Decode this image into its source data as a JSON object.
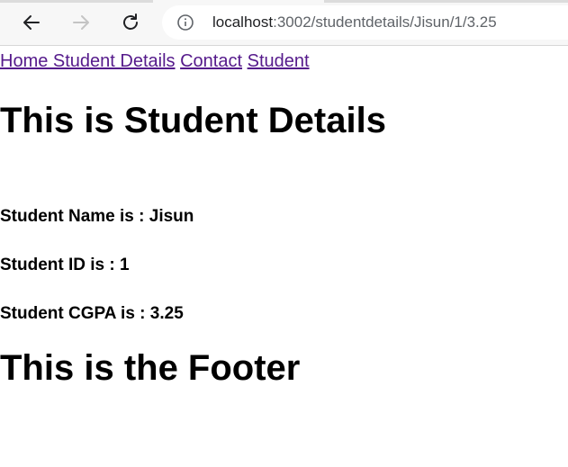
{
  "browser": {
    "url_host": "localhost",
    "url_path": ":3002/studentdetails/Jisun/1/3.25"
  },
  "nav": {
    "home_details": "Home Student Details",
    "contact": "Contact",
    "student": "Student"
  },
  "page": {
    "title": "This is Student Details",
    "name_line": "Student Name is : Jisun",
    "id_line": "Student ID is : 1",
    "cgpa_line": "Student CGPA is : 3.25",
    "footer": "This is the Footer"
  }
}
